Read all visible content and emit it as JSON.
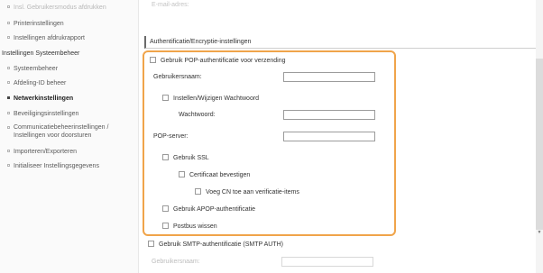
{
  "sidebar": {
    "items": [
      {
        "label": "Insl. Gebruikersmodus afdrukken",
        "type": "item",
        "state": "faded"
      },
      {
        "label": "Printerinstellingen",
        "type": "item",
        "state": "normal"
      },
      {
        "label": "Instellingen afdrukrapport",
        "type": "item",
        "state": "normal"
      },
      {
        "label": "Instellingen Systeembeheer",
        "type": "group",
        "state": "normal"
      },
      {
        "label": "Systeembeheer",
        "type": "item",
        "state": "normal"
      },
      {
        "label": "Afdeling-ID beheer",
        "type": "item",
        "state": "normal"
      },
      {
        "label": "Netwerkinstellingen",
        "type": "item",
        "state": "active"
      },
      {
        "label": "Beveiligingsinstellingen",
        "type": "item",
        "state": "normal"
      },
      {
        "label": "Communicatiebeheerinstellingen / Instellingen voor doorsturen",
        "type": "item",
        "state": "normal"
      },
      {
        "label": "Importeren/Exporteren",
        "type": "item",
        "state": "normal"
      },
      {
        "label": "Initialiseer Instellingsgegevens",
        "type": "item",
        "state": "normal"
      }
    ]
  },
  "main": {
    "faded_top_label": "E-mail-adres:",
    "section_title": "Authentificatie/Encryptie-instellingen",
    "pop": {
      "enable_label": "Gebruik POP-authentificatie voor verzending",
      "username_label": "Gebruikersnaam:",
      "username_value": "",
      "set_password_label": "Instellen/Wijzigen Wachtwoord",
      "password_label": "Wachtwoord:",
      "password_value": "",
      "server_label": "POP-server:",
      "server_value": "",
      "ssl_label": "Gebruik SSL",
      "verify_cert_label": "Certificaat bevestigen",
      "cn_label": "Voeg CN toe aan verificatie-items",
      "apop_label": "Gebruik APOP-authentificatie",
      "postbox_label": "Postbus wissen"
    },
    "smtp": {
      "enable_label": "Gebruik SMTP-authentificatie (SMTP AUTH)",
      "username_label": "Gebruikersnaam:"
    }
  },
  "colors": {
    "highlight_border": "#f0a44a",
    "text": "#333333",
    "sidebar_bg": "#fafafa"
  }
}
